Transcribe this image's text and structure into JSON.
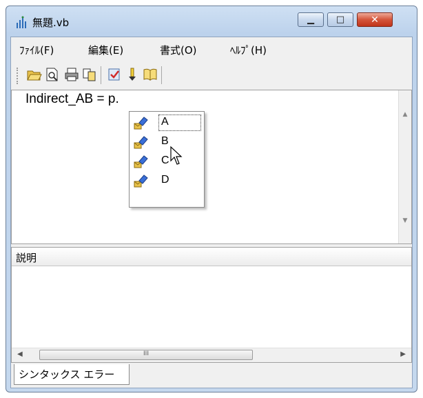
{
  "window": {
    "title": "無題.vb",
    "minimize_glyph": "▁",
    "maximize_glyph": "□",
    "close_glyph": "✕"
  },
  "menu": {
    "items": [
      {
        "label": "ﾌｧｲﾙ(F)"
      },
      {
        "label": "編集(E)"
      },
      {
        "label": "書式(O)"
      },
      {
        "label": "ﾍﾙﾌﾟ(H)"
      }
    ]
  },
  "toolbar": {
    "buttons": [
      {
        "icon": "open-folder-icon"
      },
      {
        "icon": "print-preview-icon"
      },
      {
        "icon": "print-icon"
      },
      {
        "icon": "copy-icon"
      },
      {
        "icon": "check-document-icon"
      },
      {
        "icon": "run-pointer-icon"
      },
      {
        "icon": "help-book-icon"
      }
    ]
  },
  "editor": {
    "code": "Indirect_AB = p."
  },
  "autocomplete": {
    "items": [
      {
        "label": "A",
        "selected": true
      },
      {
        "label": "B",
        "selected": false
      },
      {
        "label": "C",
        "selected": false
      },
      {
        "label": "D",
        "selected": false
      }
    ]
  },
  "panel": {
    "header": "説明",
    "scroll_thumb_glyph": "III"
  },
  "tabs": [
    {
      "label": "シンタックス エラー",
      "active": true
    }
  ],
  "colors": {
    "title_gradient": "#cfe0f3",
    "close_button": "#c0341a",
    "property_icon_blue": "#3a6fd8",
    "property_icon_envelope": "#e8c24a"
  }
}
